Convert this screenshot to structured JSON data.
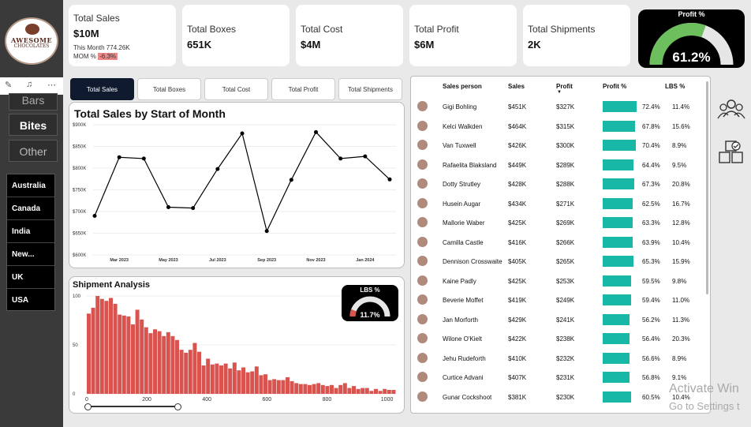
{
  "brand": {
    "line1": "AWESOME",
    "line2": "CHOCOLATES"
  },
  "sidebar": {
    "types": [
      "Bars",
      "Bites",
      "Other"
    ],
    "countries": [
      "Australia",
      "Canada",
      "India",
      "New...",
      "UK",
      "USA"
    ]
  },
  "kpis": [
    {
      "title": "Total Sales",
      "value": "$10M",
      "this_month": "This Month 774.26K",
      "mom_label": "MOM %",
      "mom_value": "-6.3%"
    },
    {
      "title": "Total Boxes",
      "value": "651K"
    },
    {
      "title": "Total Cost",
      "value": "$4M"
    },
    {
      "title": "Total Profit",
      "value": "$6M"
    },
    {
      "title": "Total Shipments",
      "value": "2K"
    }
  ],
  "profit_gauge": {
    "title": "Profit %",
    "value_text": "61.2%",
    "value": 61.2,
    "color": "#6cbf5c"
  },
  "tabs": [
    "Total Sales",
    "Total Boxes",
    "Total Cost",
    "Total Profit",
    "Total Shipments"
  ],
  "chart_data": [
    {
      "type": "line",
      "title": "Total Sales by Start of Month",
      "x": [
        "2023-01",
        "2023-02",
        "2023-03",
        "2023-04",
        "2023-05",
        "2023-06",
        "2023-07",
        "2023-08",
        "2023-09",
        "2023-10",
        "2023-11",
        "2023-12",
        "2024-01",
        "2024-02"
      ],
      "x_tick_labels": [
        "Mar 2023",
        "May 2023",
        "Jul 2023",
        "Sep 2023",
        "Nov 2023",
        "Jan 2024"
      ],
      "values": [
        690,
        825,
        822,
        710,
        708,
        798,
        880,
        655,
        773,
        883,
        822,
        827,
        774
      ],
      "y_ticks": [
        "$900K",
        "$850K",
        "$800K",
        "$750K",
        "$700K",
        "$650K",
        "$600K"
      ],
      "ylim": [
        600,
        900
      ]
    },
    {
      "type": "bar",
      "title": "Shipment Analysis",
      "x_ticks": [
        "0",
        "200",
        "400",
        "600",
        "800",
        "1000"
      ],
      "y_ticks": [
        "100",
        "50",
        "0"
      ],
      "ylim": [
        0,
        100
      ],
      "xlim": [
        0,
        1030
      ],
      "values": [
        82,
        88,
        100,
        97,
        95,
        98,
        92,
        81,
        80,
        79,
        71,
        86,
        76,
        68,
        62,
        66,
        64,
        59,
        63,
        59,
        55,
        45,
        42,
        45,
        52,
        43,
        29,
        36,
        30,
        31,
        29,
        31,
        26,
        32,
        24,
        27,
        22,
        23,
        28,
        19,
        20,
        14,
        15,
        14,
        14,
        17,
        13,
        11,
        10,
        10,
        9,
        10,
        11,
        9,
        8,
        9,
        6,
        9,
        11,
        6,
        8,
        5,
        6,
        6,
        3,
        5,
        3,
        5,
        4,
        4
      ],
      "color": "#d9534f"
    }
  ],
  "lbs_gauge": {
    "title": "LBS %",
    "value_text": "11.7%",
    "value": 11.7
  },
  "table": {
    "headers": [
      "Sales person",
      "Sales",
      "Profit",
      "Profit %",
      "LBS %"
    ],
    "rows": [
      [
        "Gigi Bohling",
        "$451K",
        "$327K",
        "72.4%",
        "11.4%"
      ],
      [
        "Kelci Walkden",
        "$464K",
        "$315K",
        "67.8%",
        "15.6%"
      ],
      [
        "Van Tuxwell",
        "$426K",
        "$300K",
        "70.4%",
        "8.9%"
      ],
      [
        "Rafaelita Blaksland",
        "$449K",
        "$289K",
        "64.4%",
        "9.5%"
      ],
      [
        "Dotty Strutley",
        "$428K",
        "$288K",
        "67.3%",
        "20.8%"
      ],
      [
        "Husein Augar",
        "$434K",
        "$271K",
        "62.5%",
        "16.7%"
      ],
      [
        "Mallorie Waber",
        "$425K",
        "$269K",
        "63.3%",
        "12.8%"
      ],
      [
        "Camilla Castle",
        "$416K",
        "$266K",
        "63.9%",
        "10.4%"
      ],
      [
        "Dennison Crosswaite",
        "$405K",
        "$265K",
        "65.3%",
        "15.9%"
      ],
      [
        "Kaine Padly",
        "$425K",
        "$253K",
        "59.5%",
        "9.8%"
      ],
      [
        "Beverie Moffet",
        "$419K",
        "$249K",
        "59.4%",
        "11.0%"
      ],
      [
        "Jan Morforth",
        "$429K",
        "$241K",
        "56.2%",
        "11.3%"
      ],
      [
        "Wilone O'Kielt",
        "$422K",
        "$238K",
        "56.4%",
        "20.3%"
      ],
      [
        "Jehu Rudeforth",
        "$410K",
        "$232K",
        "56.6%",
        "8.9%"
      ],
      [
        "Curtice Advani",
        "$407K",
        "$231K",
        "56.8%",
        "9.1%"
      ],
      [
        "Gunar Cockshoot",
        "$381K",
        "$230K",
        "60.5%",
        "10.4%"
      ]
    ],
    "bar_color": "#17b8a6"
  },
  "right_icons": [
    "people-icon",
    "boxes-icon"
  ],
  "watermark": {
    "line1": "Activate Win",
    "line2": "Go to Settings t"
  }
}
